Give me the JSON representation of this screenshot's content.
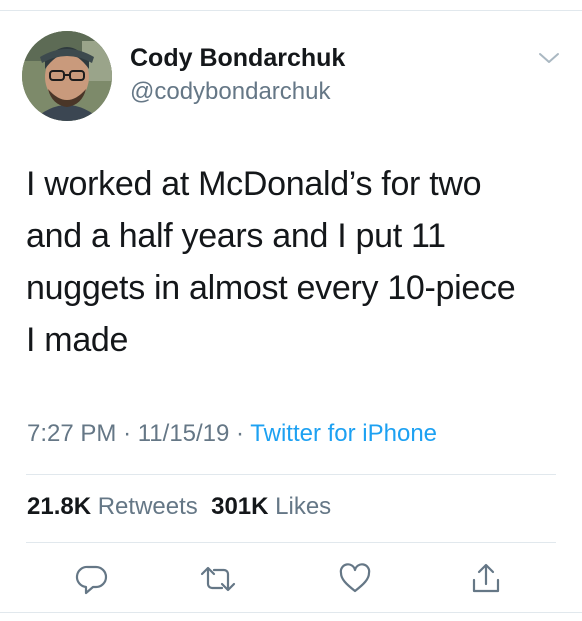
{
  "author": {
    "display_name": "Cody Bondarchuk",
    "handle": "@codybondarchuk"
  },
  "tweet": {
    "text": "I worked at McDonald’s for two\nand a half years and I put 11\nnuggets in almost every 10-piece\nI made",
    "time": "7:27 PM",
    "date": "11/15/19",
    "separator": "·",
    "source": "Twitter for iPhone"
  },
  "stats": {
    "retweets_count": "21.8K",
    "retweets_label": "Retweets",
    "likes_count": "301K",
    "likes_label": "Likes"
  },
  "icons": {
    "menu": "chevron-down-icon",
    "reply": "reply-icon",
    "retweet": "retweet-icon",
    "like": "heart-icon",
    "share": "share-icon"
  },
  "colors": {
    "text": "#14171a",
    "secondary": "#657786",
    "link": "#1da1f2",
    "divider": "#e1e8ed"
  }
}
